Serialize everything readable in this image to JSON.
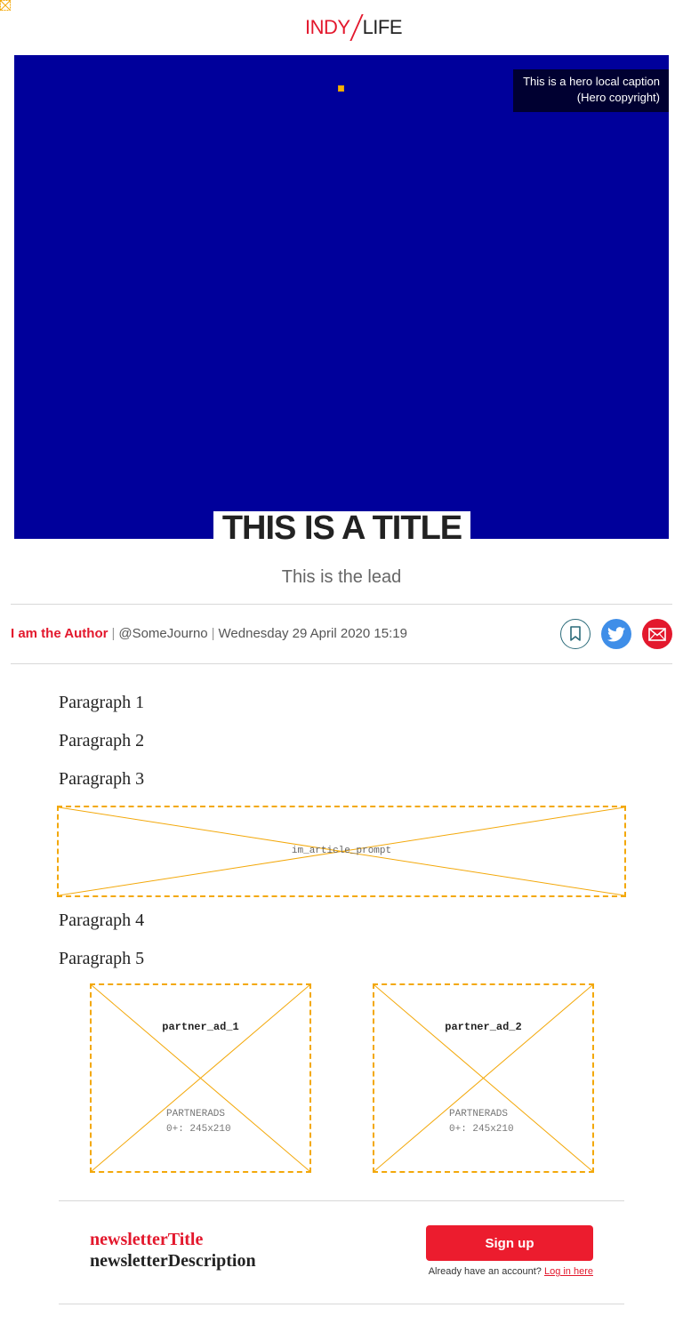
{
  "header": {
    "logo_left": "INDY",
    "logo_right": "LIFE"
  },
  "hero": {
    "caption_line1": "This is a hero local caption",
    "caption_line2": "(Hero copyright)",
    "background_color": "#00009b"
  },
  "article": {
    "title": "THIS IS A TITLE",
    "lead": "This is the lead",
    "author": "I am the Author",
    "handle": "@SomeJourno",
    "date": "Wednesday 29 April 2020 15:19",
    "paragraphs": [
      "Paragraph 1",
      "Paragraph 2",
      "Paragraph 3",
      "Paragraph 4",
      "Paragraph 5"
    ],
    "prompt_label": "im_article_prompt"
  },
  "share": {
    "icons": [
      "bookmark-icon",
      "twitter-icon",
      "mail-icon"
    ]
  },
  "ads": [
    {
      "name": "partner_ad_1",
      "meta_line1": "PARTNERADS",
      "meta_line2": "0+: 245x210"
    },
    {
      "name": "partner_ad_2",
      "meta_line1": "PARTNERADS",
      "meta_line2": "0+: 245x210"
    }
  ],
  "newsletter": {
    "title": "newsletterTitle",
    "description": "newsletterDescription",
    "signup_label": "Sign up",
    "login_prompt": "Already have an account?",
    "login_link": "Log in here"
  },
  "colors": {
    "brand_red": "#e3182d",
    "placeholder_orange": "#f3a80a",
    "twitter_blue": "#3f8ee8"
  }
}
